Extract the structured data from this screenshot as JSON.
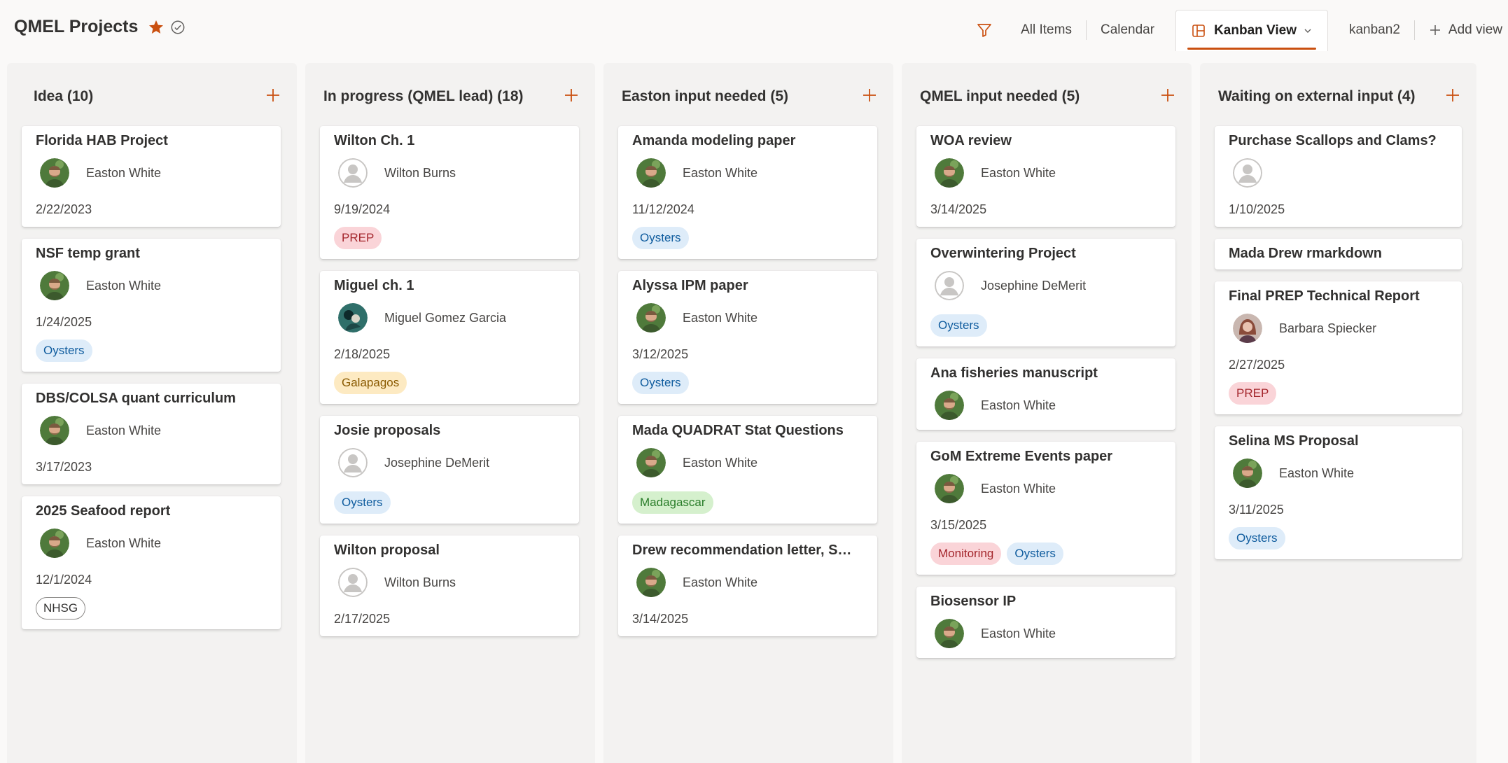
{
  "header": {
    "title": "QMEL Projects",
    "views": {
      "all_items": "All Items",
      "calendar": "Calendar",
      "kanban_view": "Kanban View",
      "kanban2": "kanban2",
      "add_view": "Add view"
    }
  },
  "colors": {
    "accent": "#ca5010",
    "tag_colors": {
      "Oysters": {
        "bg": "#deecf9",
        "fg": "#0f5c9e",
        "border": "#deecf9"
      },
      "PREP": {
        "bg": "#fad4d8",
        "fg": "#a4262c",
        "border": "#fad4d8"
      },
      "Galapagos": {
        "bg": "#fdeac2",
        "fg": "#8a5a00",
        "border": "#fdeac2"
      },
      "Madagascar": {
        "bg": "#d5f0cd",
        "fg": "#2a7d2a",
        "border": "#d5f0cd"
      },
      "Monitoring": {
        "bg": "#fad4d8",
        "fg": "#a4262c",
        "border": "#fad4d8"
      },
      "NHSG": {
        "bg": "#ffffff",
        "fg": "#323130",
        "border": "#8a8886"
      }
    }
  },
  "columns": [
    {
      "title": "Idea (10)",
      "cards": [
        {
          "title": "Florida HAB Project",
          "person": "Easton White",
          "avatar": "photo-easton",
          "date": "2/22/2023",
          "tags": []
        },
        {
          "title": "NSF temp grant",
          "person": "Easton White",
          "avatar": "photo-easton",
          "date": "1/24/2025",
          "tags": [
            "Oysters"
          ]
        },
        {
          "title": "DBS/COLSA quant curriculum",
          "person": "Easton White",
          "avatar": "photo-easton",
          "date": "3/17/2023",
          "tags": []
        },
        {
          "title": "2025 Seafood report",
          "person": "Easton White",
          "avatar": "photo-easton",
          "date": "12/1/2024",
          "tags": [
            "NHSG"
          ]
        }
      ]
    },
    {
      "title": "In progress (QMEL lead) (18)",
      "cards": [
        {
          "title": "Wilton Ch. 1",
          "person": "Wilton Burns",
          "avatar": "placeholder",
          "date": "9/19/2024",
          "tags": [
            "PREP"
          ]
        },
        {
          "title": "Miguel ch. 1",
          "person": "Miguel Gomez Garcia",
          "avatar": "photo-miguel",
          "date": "2/18/2025",
          "tags": [
            "Galapagos"
          ]
        },
        {
          "title": "Josie proposals",
          "person": "Josephine DeMerit",
          "avatar": "placeholder",
          "date": "",
          "tags": [
            "Oysters"
          ]
        },
        {
          "title": "Wilton proposal",
          "person": "Wilton Burns",
          "avatar": "placeholder",
          "date": "2/17/2025",
          "tags": []
        }
      ]
    },
    {
      "title": "Easton input needed (5)",
      "cards": [
        {
          "title": "Amanda modeling paper",
          "person": "Easton White",
          "avatar": "photo-easton",
          "date": "11/12/2024",
          "tags": [
            "Oysters"
          ]
        },
        {
          "title": "Alyssa IPM paper",
          "person": "Easton White",
          "avatar": "photo-easton",
          "date": "3/12/2025",
          "tags": [
            "Oysters"
          ]
        },
        {
          "title": "Mada QUADRAT Stat Questions",
          "person": "Easton White",
          "avatar": "photo-easton",
          "date": "",
          "tags": [
            "Madagascar"
          ]
        },
        {
          "title": "Drew recommendation letter, SMS...",
          "person": "Easton White",
          "avatar": "photo-easton",
          "date": "3/14/2025",
          "tags": []
        }
      ]
    },
    {
      "title": "QMEL input needed (5)",
      "cards": [
        {
          "title": "WOA review",
          "person": "Easton White",
          "avatar": "photo-easton",
          "date": "3/14/2025",
          "tags": []
        },
        {
          "title": "Overwintering Project",
          "person": "Josephine DeMerit",
          "avatar": "placeholder",
          "date": "",
          "tags": [
            "Oysters"
          ]
        },
        {
          "title": "Ana fisheries manuscript",
          "person": "Easton White",
          "avatar": "photo-easton",
          "date": "",
          "tags": []
        },
        {
          "title": "GoM Extreme Events paper",
          "person": "Easton White",
          "avatar": "photo-easton",
          "date": "3/15/2025",
          "tags": [
            "Monitoring",
            "Oysters"
          ]
        },
        {
          "title": "Biosensor IP",
          "person": "Easton White",
          "avatar": "photo-easton",
          "date": "",
          "tags": []
        }
      ]
    },
    {
      "title": "Waiting on external input (4)",
      "cards": [
        {
          "title": "Purchase Scallops and Clams?",
          "person": "",
          "avatar": "placeholder",
          "date": "1/10/2025",
          "tags": []
        },
        {
          "title": "Mada Drew rmarkdown",
          "person": "",
          "avatar": "",
          "date": "",
          "tags": []
        },
        {
          "title": "Final PREP Technical Report",
          "person": "Barbara Spiecker",
          "avatar": "photo-barbara",
          "date": "2/27/2025",
          "tags": [
            "PREP"
          ]
        },
        {
          "title": "Selina MS Proposal",
          "person": "Easton White",
          "avatar": "photo-easton",
          "date": "3/11/2025",
          "tags": [
            "Oysters"
          ]
        }
      ]
    }
  ]
}
